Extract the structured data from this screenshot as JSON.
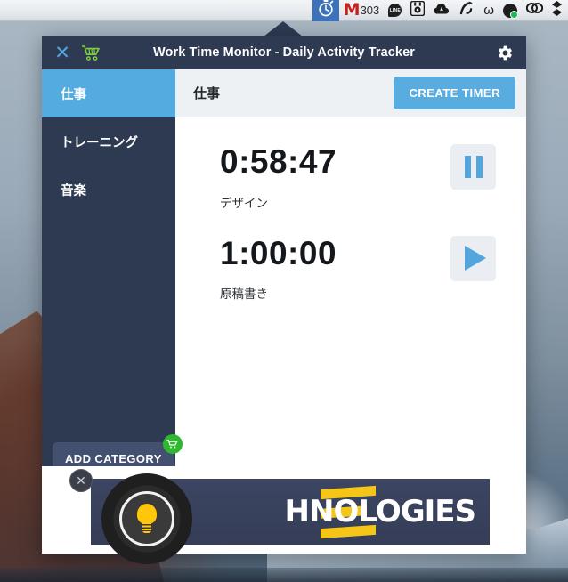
{
  "menubar": {
    "items": [
      {
        "name": "stopwatch",
        "icon": "stopwatch-icon",
        "label": "",
        "active": true
      },
      {
        "name": "gmail",
        "icon": "gmail-icon",
        "label": "M",
        "count": "303",
        "active": false
      },
      {
        "name": "line",
        "icon": "line-icon",
        "label": "LINE",
        "active": false
      },
      {
        "name": "backup",
        "icon": "backup-drive-icon",
        "label": "",
        "active": false
      },
      {
        "name": "cloud",
        "icon": "cloud-icon",
        "label": "",
        "active": false
      },
      {
        "name": "arrow-loop",
        "icon": "arrow-loop-icon",
        "label": "",
        "active": false
      },
      {
        "name": "omega",
        "icon": "omega-icon",
        "label": "ω",
        "active": false
      },
      {
        "name": "sync-check",
        "icon": "sync-check-icon",
        "label": "✓",
        "active": false
      },
      {
        "name": "creative-cloud",
        "icon": "creative-cloud-icon",
        "label": "",
        "active": false
      },
      {
        "name": "dropbox",
        "icon": "dropbox-icon",
        "label": "",
        "active": false
      }
    ]
  },
  "window": {
    "title": "Work Time Monitor - Daily Activity Tracker",
    "close_icon": "✕",
    "cart_icon": "cart-icon",
    "gear_icon": "gear-icon",
    "accent_color": "#54abe0",
    "titlebar_color": "#2e3a52"
  },
  "sidebar": {
    "categories": [
      {
        "label": "仕事",
        "selected": true
      },
      {
        "label": "トレーニング",
        "selected": false
      },
      {
        "label": "音楽",
        "selected": false
      }
    ],
    "add_category_label": "ADD CATEGORY",
    "add_category_badge_icon": "cart-badge-icon"
  },
  "content": {
    "header_title": "仕事",
    "create_timer_label": "CREATE TIMER",
    "timers": [
      {
        "time": "0:58:47",
        "label": "デザイン",
        "state": "running",
        "button_icon": "pause-icon"
      },
      {
        "time": "1:00:00",
        "label": "原稿書き",
        "state": "stopped",
        "button_icon": "play-icon"
      }
    ]
  },
  "ad": {
    "close_icon": "✕",
    "bulb_icon": "lightbulb-icon",
    "text": "HNOLOGIES",
    "accent_color": "#f5c518",
    "background_color": "#3c4561"
  }
}
